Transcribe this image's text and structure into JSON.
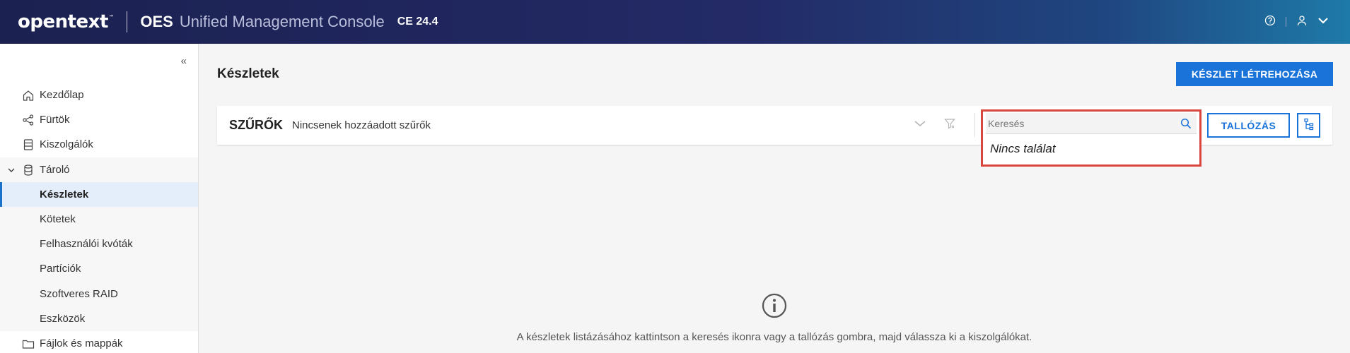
{
  "header": {
    "logo": "opentext",
    "logo_tm": "™",
    "product_short": "OES",
    "product_name": "Unified Management Console",
    "version": "CE 24.4",
    "icons": [
      "help-icon",
      "user-icon",
      "chevron-down-icon"
    ]
  },
  "sidebar": {
    "collapse_label": "«",
    "items": [
      {
        "label": "Kezdőlap",
        "icon": "home-icon"
      },
      {
        "label": "Fürtök",
        "icon": "share-icon"
      },
      {
        "label": "Kiszolgálók",
        "icon": "server-icon"
      },
      {
        "label": "Tároló",
        "icon": "database-icon",
        "expanded": true
      },
      {
        "label": "Készletek",
        "active": true
      },
      {
        "label": "Kötetek"
      },
      {
        "label": "Felhasználói kvóták"
      },
      {
        "label": "Partíciók"
      },
      {
        "label": "Szoftveres RAID"
      },
      {
        "label": "Eszközök"
      },
      {
        "label": "Fájlok és mappák",
        "icon": "folder-icon"
      }
    ]
  },
  "main": {
    "page_title": "Készletek",
    "create_button": "KÉSZLET LÉTREHOZÁSA",
    "filters": {
      "title": "SZŰRŐK",
      "status": "Nincsenek hozzáadott szűrők"
    },
    "search": {
      "placeholder": "Keresés",
      "value": "",
      "no_result": "Nincs találat"
    },
    "browse_button": "TALLÓZÁS",
    "empty_message": "A készletek listázásához kattintson a keresés ikonra vagy a tallózás gombra, majd válassza ki a kiszolgálókat."
  },
  "colors": {
    "accent": "#1a73d9",
    "highlight_border": "#d9463f",
    "header_start": "#1b2150",
    "header_end": "#1e7aa8"
  }
}
